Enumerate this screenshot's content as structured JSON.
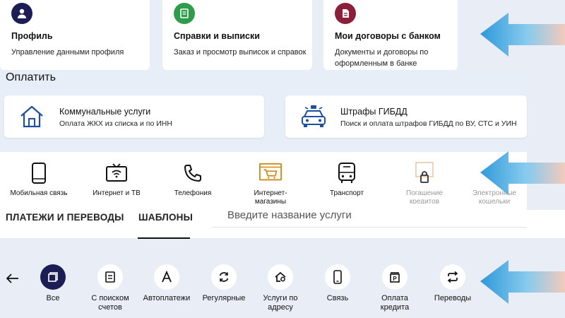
{
  "top_cards": [
    {
      "title": "Профиль",
      "desc": "Управление данными профиля",
      "icon": "user-icon",
      "color": "#1c1d55"
    },
    {
      "title": "Справки и выписки",
      "desc": "Заказ и просмотр выписок и справок",
      "icon": "document-list-icon",
      "color": "#2e9c4a"
    },
    {
      "title": "Мои договоры с банком",
      "desc": "Документы и договоры по оформленным в банке продуктам",
      "icon": "contract-icon",
      "color": "#8b1f3a"
    }
  ],
  "pay": {
    "title": "Оплатить",
    "cards": [
      {
        "title": "Коммунальные услуги",
        "desc": "Оплата ЖКХ из списка и по ИНН",
        "icon": "house-icon"
      },
      {
        "title": "Штрафы ГИБДД",
        "desc": "Поиск и оплата штрафов ГИБДД по ВУ, СТС и УИН",
        "icon": "police-car-icon"
      }
    ]
  },
  "categories": [
    {
      "label": "Мобильная связь",
      "icon": "mobile-phone-icon"
    },
    {
      "label": "Интернет и ТВ",
      "icon": "tv-wifi-icon"
    },
    {
      "label": "Телефония",
      "icon": "phone-handset-icon"
    },
    {
      "label": "Интернет-магазины",
      "icon": "online-shop-icon"
    },
    {
      "label": "Транспорт",
      "icon": "bus-icon"
    },
    {
      "label": "Погашение кредитов",
      "icon": "credit-lock-icon"
    },
    {
      "label": "Электронные кошельки",
      "icon": "wallet-icon"
    }
  ],
  "tabs": {
    "payments": "ПЛАТЕЖИ И ПЕРЕВОДЫ",
    "templates": "ШАБЛОНЫ"
  },
  "search": {
    "placeholder": "Введите название услуги"
  },
  "filters": [
    {
      "label": "Все",
      "icon": "all-icon",
      "active": true
    },
    {
      "label": "С поиском счетов",
      "icon": "invoice-search-icon"
    },
    {
      "label": "Автоплатежи",
      "icon": "autopay-icon"
    },
    {
      "label": "Регулярные",
      "icon": "refresh-icon"
    },
    {
      "label": "Услуги по адресу",
      "icon": "address-icon"
    },
    {
      "label": "Связь",
      "icon": "smartphone-icon"
    },
    {
      "label": "Оплата кредита",
      "icon": "credit-payment-icon"
    },
    {
      "label": "Переводы",
      "icon": "transfer-icon"
    }
  ],
  "colors": {
    "accent_dark": "#1c1d55",
    "shop_orange": "#d08a1a",
    "background": "#e9eef6"
  }
}
